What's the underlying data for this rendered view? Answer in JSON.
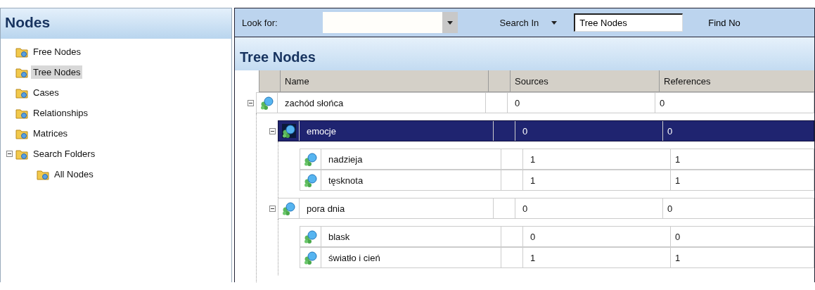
{
  "sidebar": {
    "title": "Nodes",
    "items": [
      {
        "label": "Free Nodes",
        "selected": false
      },
      {
        "label": "Tree Nodes",
        "selected": true
      },
      {
        "label": "Cases",
        "selected": false
      },
      {
        "label": "Relationships",
        "selected": false
      },
      {
        "label": "Matrices",
        "selected": false
      },
      {
        "label": "Search Folders",
        "selected": false,
        "expanded": true,
        "children": [
          {
            "label": "All Nodes",
            "selected": false
          }
        ]
      }
    ]
  },
  "toolbar": {
    "look_for_label": "Look for:",
    "search_in_label": "Search In",
    "search_in_value": "Tree Nodes",
    "find_button": "Find No"
  },
  "tree": {
    "title": "Tree Nodes",
    "columns": [
      "Name",
      "Sources",
      "References"
    ],
    "rows": [
      {
        "name": "zachód słońca",
        "sources": "0",
        "references": "0",
        "selected": false,
        "expanded": true,
        "children": [
          {
            "name": "emocje",
            "sources": "0",
            "references": "0",
            "selected": true,
            "expanded": true,
            "children": [
              {
                "name": "nadzieja",
                "sources": "1",
                "references": "1",
                "selected": false
              },
              {
                "name": "tęsknota",
                "sources": "1",
                "references": "1",
                "selected": false
              }
            ]
          },
          {
            "name": "pora dnia",
            "sources": "0",
            "references": "0",
            "selected": false,
            "expanded": true,
            "children": [
              {
                "name": "blask",
                "sources": "0",
                "references": "0",
                "selected": false
              },
              {
                "name": "światło i cień",
                "sources": "1",
                "references": "1",
                "selected": false
              }
            ]
          }
        ]
      }
    ]
  }
}
